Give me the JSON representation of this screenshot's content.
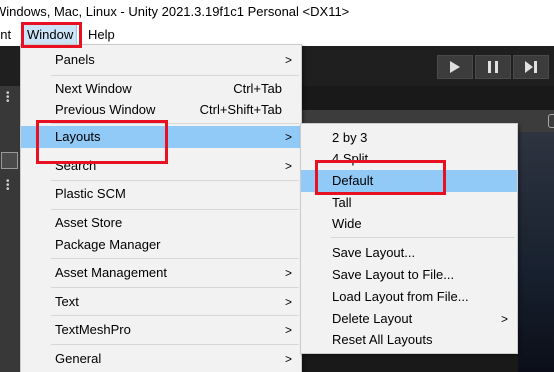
{
  "title_bar": {
    "text": "Windows, Mac, Linux - Unity 2021.3.19f1c1 Personal <DX11>"
  },
  "menu_bar": {
    "component_label": "ent",
    "window_label": "Window",
    "help_label": "Help"
  },
  "toolbar": {
    "play_icon": "play-icon",
    "pause_icon": "pause-icon",
    "step_icon": "step-icon"
  },
  "window_menu": {
    "items": [
      {
        "label": "Panels",
        "shortcut": "",
        "submenu": true
      },
      {
        "label": "Next Window",
        "shortcut": "Ctrl+Tab",
        "submenu": false
      },
      {
        "label": "Previous Window",
        "shortcut": "Ctrl+Shift+Tab",
        "submenu": false
      },
      {
        "label": "Layouts",
        "shortcut": "",
        "submenu": true,
        "highlighted": true
      },
      {
        "label": "Search",
        "shortcut": "",
        "submenu": true
      },
      {
        "label": "Plastic SCM",
        "shortcut": "",
        "submenu": false
      },
      {
        "label": "Asset Store",
        "shortcut": "",
        "submenu": false
      },
      {
        "label": "Package Manager",
        "shortcut": "",
        "submenu": false
      },
      {
        "label": "Asset Management",
        "shortcut": "",
        "submenu": true
      },
      {
        "label": "Text",
        "shortcut": "",
        "submenu": true
      },
      {
        "label": "TextMeshPro",
        "shortcut": "",
        "submenu": true
      },
      {
        "label": "General",
        "shortcut": "",
        "submenu": true
      }
    ],
    "submenu_arrow": ">"
  },
  "layouts_menu": {
    "items": [
      {
        "label": "2 by 3",
        "submenu": false
      },
      {
        "label": "4 Split",
        "submenu": false
      },
      {
        "label": "Default",
        "submenu": false,
        "highlighted": true
      },
      {
        "label": "Tall",
        "submenu": false
      },
      {
        "label": "Wide",
        "submenu": false
      },
      {
        "label": "Save Layout...",
        "submenu": false
      },
      {
        "label": "Save Layout to File...",
        "submenu": false
      },
      {
        "label": "Load Layout from File...",
        "submenu": false
      },
      {
        "label": "Delete Layout",
        "submenu": true
      },
      {
        "label": "Reset All Layouts",
        "submenu": false
      }
    ]
  },
  "colors": {
    "highlight": "#91c9f7",
    "annotation_red": "#e81123",
    "menu_bg": "#f2f2f2"
  }
}
